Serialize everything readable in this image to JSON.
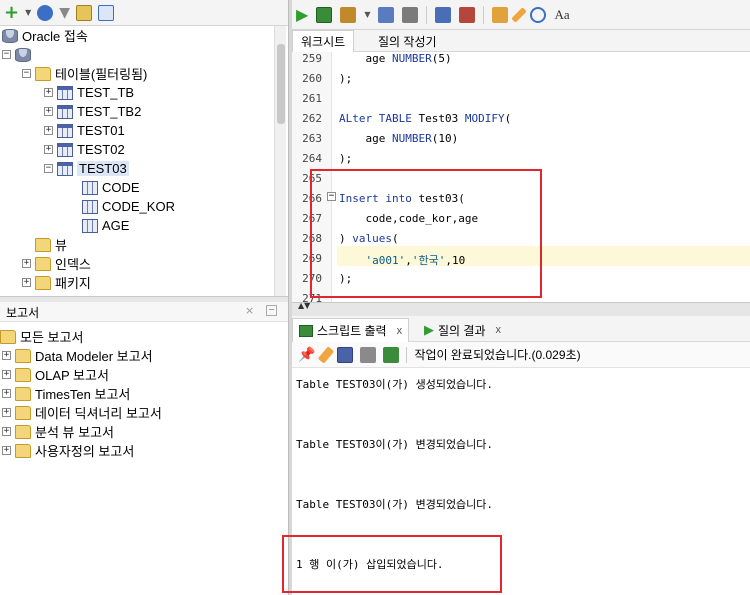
{
  "left_tree": {
    "connection_label": "Oracle 접속",
    "tables_folder": "테이블(필터링됨)",
    "tables": [
      "TEST_TB",
      "TEST_TB2",
      "TEST01",
      "TEST02",
      "TEST03"
    ],
    "columns": [
      "CODE",
      "CODE_KOR",
      "AGE"
    ],
    "views_folder": "뷰",
    "indexes_folder": "인덱스",
    "packages_folder": "패키지"
  },
  "reports": {
    "panel_title": "보고서",
    "root": "모든 보고서",
    "items": [
      "Data Modeler 보고서",
      "OLAP 보고서",
      "TimesTen 보고서",
      "데이터 딕셔너리 보고서",
      "분석 뷰 보고서",
      "사용자정의 보고서"
    ]
  },
  "editor": {
    "tabs": [
      "워크시트",
      "질의 작성기"
    ],
    "lines": [
      {
        "n": "259",
        "text": "    age NUMBER(5)"
      },
      {
        "n": "260",
        "text": ");"
      },
      {
        "n": "261",
        "text": ""
      },
      {
        "n": "262",
        "text": "ALter TABLE Test03 MODIFY("
      },
      {
        "n": "263",
        "text": "    age NUMBER(10)"
      },
      {
        "n": "264",
        "text": ");"
      },
      {
        "n": "265",
        "text": ""
      },
      {
        "n": "266",
        "text": "Insert into test03("
      },
      {
        "n": "267",
        "text": "    code,code_kor,age"
      },
      {
        "n": "268",
        "text": ") values("
      },
      {
        "n": "269",
        "text": "    'a001','한국',10"
      },
      {
        "n": "270",
        "text": ");"
      },
      {
        "n": "271",
        "text": ""
      }
    ]
  },
  "output": {
    "tabs": [
      "스크립트 출력",
      "질의 결과"
    ],
    "close_glyph": "x",
    "status": "작업이 완료되었습니다.(0.029초)",
    "messages": [
      "Table TEST03이(가) 생성되었습니다.",
      "Table TEST03이(가) 변경되었습니다.",
      "Table TEST03이(가) 변경되었습니다.",
      "1 행 이(가) 삽입되었습니다."
    ]
  }
}
